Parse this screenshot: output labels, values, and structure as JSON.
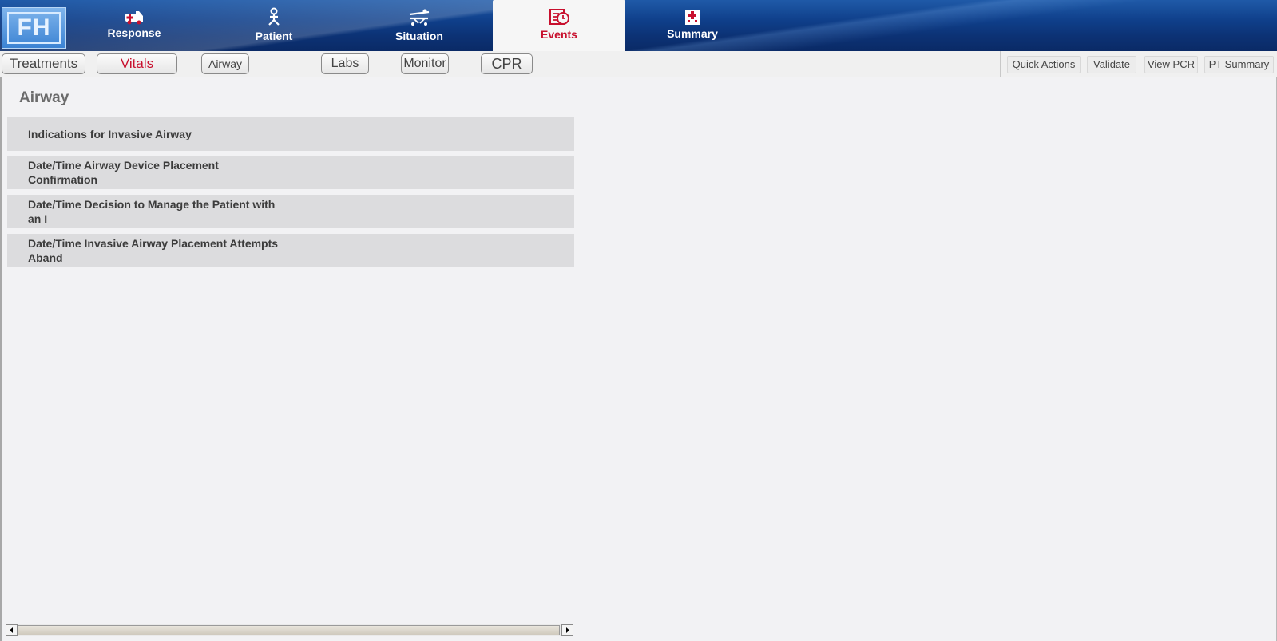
{
  "app": {
    "logo_text": "FH"
  },
  "nav": {
    "tabs": [
      {
        "label": "Response",
        "icon": "ambulance-icon"
      },
      {
        "label": "Patient",
        "icon": "patient-icon"
      },
      {
        "label": "Situation",
        "icon": "stretcher-icon"
      },
      {
        "label": "Events",
        "icon": "clock-events-icon",
        "active": true
      },
      {
        "label": "Summary",
        "icon": "hospital-icon"
      }
    ]
  },
  "subtabs": {
    "items": [
      {
        "label": "Treatments"
      },
      {
        "label": "Vitals",
        "selected": true
      },
      {
        "label": "Airway"
      },
      {
        "label": "Labs"
      },
      {
        "label": "Monitor"
      },
      {
        "label": "CPR"
      }
    ]
  },
  "actions": {
    "quick_actions": "Quick Actions",
    "validate": "Validate",
    "view_pcr": "View PCR",
    "pt_summary": "PT Summary"
  },
  "section": {
    "title": "Airway",
    "rows": [
      {
        "label": "Indications for Invasive Airway"
      },
      {
        "label": "Date/Time Airway Device Placement Confirmation"
      },
      {
        "label": "Date/Time Decision to Manage the Patient with an I"
      },
      {
        "label": "Date/Time Invasive Airway Placement Attempts Aband"
      }
    ]
  },
  "colors": {
    "accent_red": "#c8102e",
    "nav_blue": "#0c3275"
  }
}
